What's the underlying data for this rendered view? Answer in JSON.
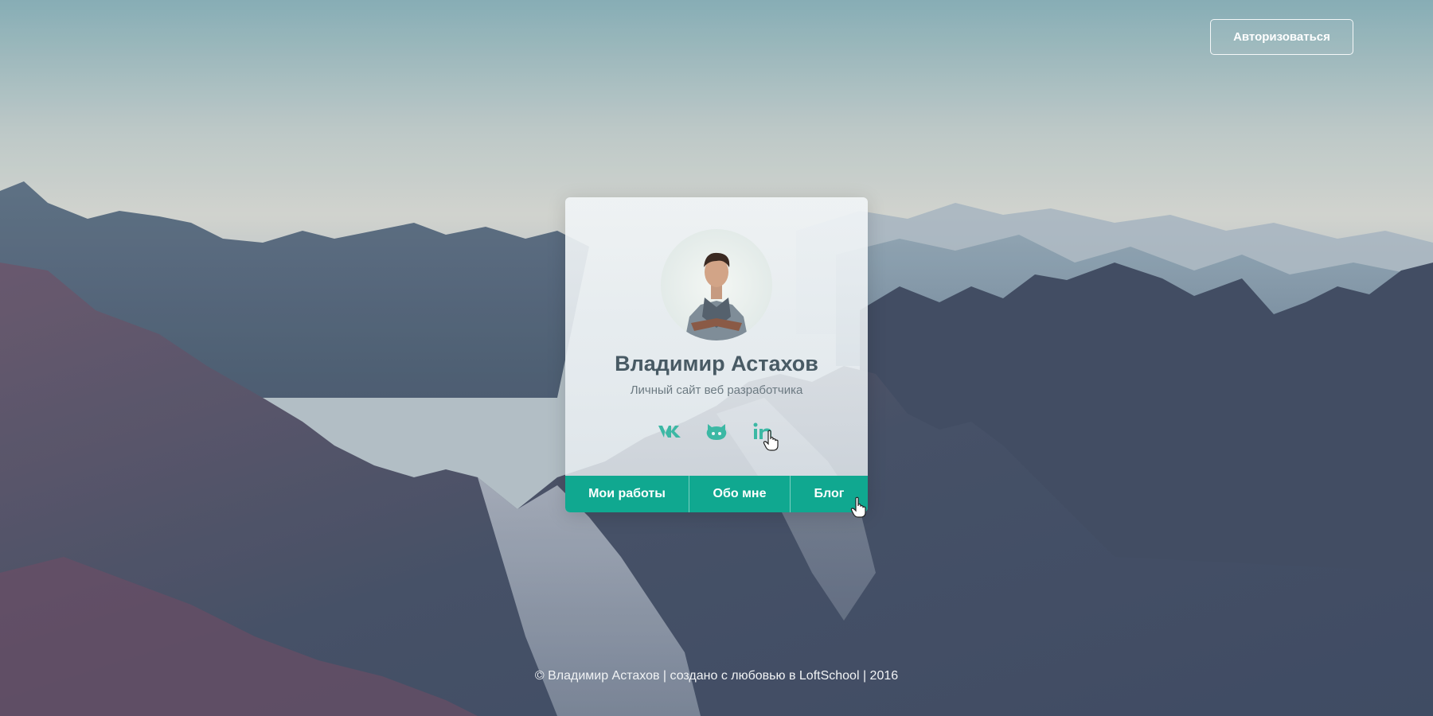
{
  "header": {
    "auth_label": "Авторизоваться"
  },
  "profile": {
    "name": "Владимир Астахов",
    "subtitle": "Личный сайт веб разработчика"
  },
  "socials": [
    {
      "icon": "vk-icon"
    },
    {
      "icon": "github-icon"
    },
    {
      "icon": "linkedin-icon"
    }
  ],
  "nav": {
    "items": [
      "Мои работы",
      "Обо мне",
      "Блог"
    ]
  },
  "footer": {
    "text": "© Владимир Астахов | создано с любовью в LoftSchool | 2016"
  },
  "colors": {
    "accent": "#10a890",
    "text_dark": "#485a64"
  }
}
